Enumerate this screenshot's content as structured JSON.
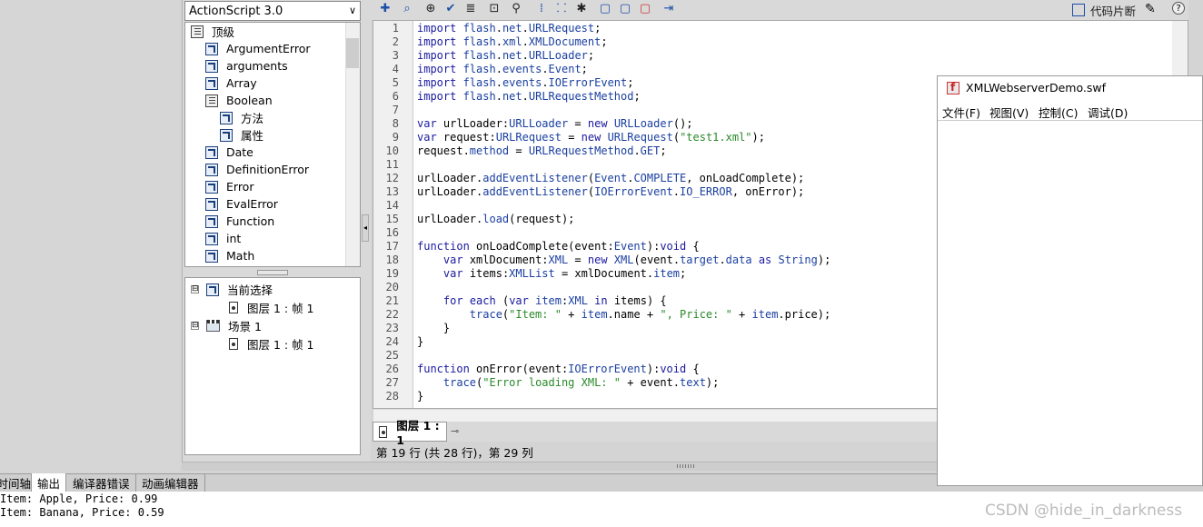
{
  "actions_panel": {
    "language": "ActionScript 3.0",
    "toolbox_items": [
      {
        "label": "顶级",
        "icon": "book-icon"
      },
      {
        "label": "ArgumentError",
        "icon": "class-icon"
      },
      {
        "label": "arguments",
        "icon": "class-icon"
      },
      {
        "label": "Array",
        "icon": "class-icon"
      },
      {
        "label": "Boolean",
        "icon": "book-icon"
      },
      {
        "label": "方法",
        "icon": "class-icon"
      },
      {
        "label": "属性",
        "icon": "class-icon"
      },
      {
        "label": "Date",
        "icon": "class-icon"
      },
      {
        "label": "DefinitionError",
        "icon": "class-icon"
      },
      {
        "label": "Error",
        "icon": "class-icon"
      },
      {
        "label": "EvalError",
        "icon": "class-icon"
      },
      {
        "label": "Function",
        "icon": "class-icon"
      },
      {
        "label": "int",
        "icon": "class-icon"
      },
      {
        "label": "Math",
        "icon": "class-icon"
      }
    ],
    "scene_tree": [
      {
        "label": "当前选择",
        "expander": "⊟"
      },
      {
        "label": "图层 1 : 帧 1"
      },
      {
        "label": "场景 1",
        "expander": "⊟"
      },
      {
        "label": "图层 1 : 帧 1"
      }
    ]
  },
  "toolbar": {
    "icons": [
      "add-icon",
      "find-icon",
      "target-icon",
      "check-icon",
      "format-icon",
      "debug-icon",
      "code-hint-icon",
      "collapse-icon",
      "collapse-selection-icon",
      "expand-all-icon",
      "comment-icon",
      "line-comment-icon",
      "uncomment-icon",
      "show-toolbox-icon"
    ],
    "snippets_label": "代码片断"
  },
  "editor": {
    "line_numbers": [
      "1",
      "2",
      "3",
      "4",
      "5",
      "6",
      "7",
      "8",
      "9",
      "10",
      "11",
      "12",
      "13",
      "14",
      "15",
      "16",
      "17",
      "18",
      "19",
      "20",
      "21",
      "22",
      "23",
      "24",
      "25",
      "26",
      "27",
      "28"
    ],
    "lines": [
      "import flash.net.URLRequest;",
      "import flash.xml.XMLDocument;",
      "import flash.net.URLLoader;",
      "import flash.events.Event;",
      "import flash.events.IOErrorEvent;",
      "import flash.net.URLRequestMethod;",
      "",
      "var urlLoader:URLLoader = new URLLoader();",
      "var request:URLRequest = new URLRequest(\"test1.xml\");",
      "request.method = URLRequestMethod.GET;",
      "",
      "urlLoader.addEventListener(Event.COMPLETE, onLoadComplete);",
      "urlLoader.addEventListener(IOErrorEvent.IO_ERROR, onError);",
      "",
      "urlLoader.load(request);",
      "",
      "function onLoadComplete(event:Event):void {",
      "    var xmlDocument:XML = new XML(event.target.data as String);",
      "    var items:XMLList = xmlDocument.item;",
      "",
      "    for each (var item:XML in items) {",
      "        trace(\"Item: \" + item.name + \", Price: \" + item.price);",
      "    }",
      "}",
      "",
      "function onError(event:IOErrorEvent):void {",
      "    trace(\"Error loading XML: \" + event.text);",
      "}"
    ],
    "tab_label": "图层 1 : 1",
    "status": "第 19 行 (共 28 行)，第 29 列"
  },
  "bottom_panel": {
    "tabs": [
      "时间轴",
      "输出",
      "编译器错误",
      "动画编辑器"
    ],
    "active_tab": "输出",
    "output_lines": [
      "Item: Apple, Price: 0.99",
      "Item: Banana, Price: 0.59"
    ]
  },
  "swf_window": {
    "title": "XMLWebserverDemo.swf",
    "menu": [
      "文件(F)",
      "视图(V)",
      "控制(C)",
      "调试(D)"
    ]
  },
  "watermark": "CSDN @hide_in_darkness"
}
